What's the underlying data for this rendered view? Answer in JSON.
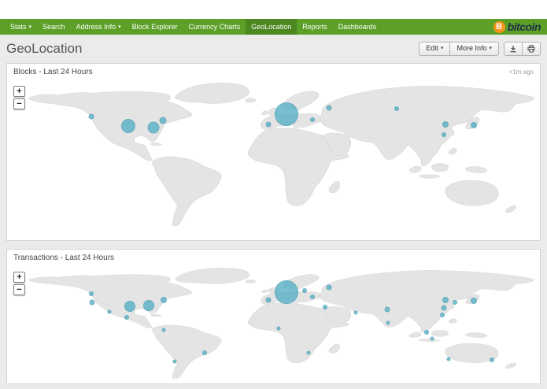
{
  "brand": {
    "name": "bitcoin",
    "coin_symbol": "B",
    "coin_color": "#f7931a",
    "text_color": "#1f3044"
  },
  "nav": {
    "bg_color": "#5ca028",
    "active_bg_color": "#4c871f",
    "items": [
      {
        "label": "Stats",
        "caret": true,
        "active": false
      },
      {
        "label": "Search",
        "caret": false,
        "active": false
      },
      {
        "label": "Address Info",
        "caret": true,
        "active": false
      },
      {
        "label": "Block Explorer",
        "caret": false,
        "active": false
      },
      {
        "label": "Currency Charts",
        "caret": false,
        "active": false
      },
      {
        "label": "GeoLocation",
        "caret": false,
        "active": true
      },
      {
        "label": "Reports",
        "caret": false,
        "active": false
      },
      {
        "label": "Dashboards",
        "caret": false,
        "active": false
      }
    ]
  },
  "header": {
    "title": "GeoLocation",
    "edit_label": "Edit",
    "more_info_label": "More Info"
  },
  "map": {
    "bubble_color": "#58b2c7",
    "land_color": "#e4e4e4",
    "zoom_in": "+",
    "zoom_out": "−"
  },
  "panels": [
    {
      "title": "Blocks - Last 24 Hours",
      "timestamp": "<1m ago",
      "bubbles": [
        {
          "x": 52.4,
          "y": 22.5,
          "r": 15
        },
        {
          "x": 49.0,
          "y": 29.3,
          "r": 3.5
        },
        {
          "x": 60.4,
          "y": 18.5,
          "r": 3.5
        },
        {
          "x": 57.3,
          "y": 26.5,
          "r": 3
        },
        {
          "x": 22.8,
          "y": 30.3,
          "r": 9
        },
        {
          "x": 27.5,
          "y": 31.5,
          "r": 7.5
        },
        {
          "x": 29.2,
          "y": 26.8,
          "r": 4.5
        },
        {
          "x": 15.8,
          "y": 24.2,
          "r": 3.5
        },
        {
          "x": 82.3,
          "y": 29.6,
          "r": 4
        },
        {
          "x": 82.0,
          "y": 36.0,
          "r": 3
        },
        {
          "x": 87.6,
          "y": 29.8,
          "r": 4
        },
        {
          "x": 73.1,
          "y": 19.0,
          "r": 3
        }
      ]
    },
    {
      "title": "Transactions - Last 24 Hours",
      "timestamp": "",
      "bubbles": [
        {
          "x": 52.4,
          "y": 22.5,
          "r": 15
        },
        {
          "x": 49.0,
          "y": 29.3,
          "r": 3.5
        },
        {
          "x": 55.8,
          "y": 21.0,
          "r": 3
        },
        {
          "x": 60.4,
          "y": 18.5,
          "r": 3.5
        },
        {
          "x": 57.3,
          "y": 26.5,
          "r": 3
        },
        {
          "x": 23.1,
          "y": 34.6,
          "r": 7
        },
        {
          "x": 26.6,
          "y": 34.0,
          "r": 7
        },
        {
          "x": 29.4,
          "y": 29.1,
          "r": 4
        },
        {
          "x": 15.8,
          "y": 24.2,
          "r": 3
        },
        {
          "x": 16.0,
          "y": 31.1,
          "r": 3.5
        },
        {
          "x": 22.5,
          "y": 44.1,
          "r": 3
        },
        {
          "x": 19.2,
          "y": 39.0,
          "r": 2.5
        },
        {
          "x": 29.4,
          "y": 54.4,
          "r": 2.5
        },
        {
          "x": 37.1,
          "y": 74.3,
          "r": 3
        },
        {
          "x": 31.4,
          "y": 81.0,
          "r": 2.5
        },
        {
          "x": 50.9,
          "y": 53.2,
          "r": 2.5
        },
        {
          "x": 56.5,
          "y": 74.0,
          "r": 2.5
        },
        {
          "x": 59.7,
          "y": 35.1,
          "r": 3
        },
        {
          "x": 65.4,
          "y": 39.9,
          "r": 2.5
        },
        {
          "x": 71.4,
          "y": 37.6,
          "r": 3.5
        },
        {
          "x": 71.5,
          "y": 48.6,
          "r": 2.5
        },
        {
          "x": 82.3,
          "y": 29.6,
          "r": 4
        },
        {
          "x": 82.0,
          "y": 36.0,
          "r": 3.5
        },
        {
          "x": 81.7,
          "y": 42.0,
          "r": 3
        },
        {
          "x": 87.6,
          "y": 29.8,
          "r": 4
        },
        {
          "x": 84.0,
          "y": 31.0,
          "r": 3
        },
        {
          "x": 78.8,
          "y": 56.8,
          "r": 3
        },
        {
          "x": 79.7,
          "y": 62.1,
          "r": 2.5
        },
        {
          "x": 91.0,
          "y": 80.0,
          "r": 3
        },
        {
          "x": 82.8,
          "y": 79.0,
          "r": 2.5
        }
      ]
    }
  ]
}
